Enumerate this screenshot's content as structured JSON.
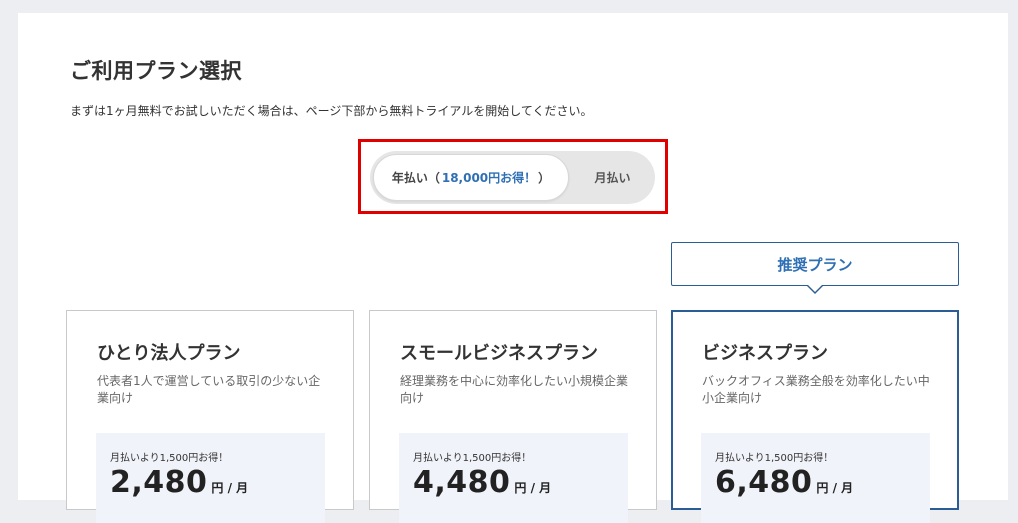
{
  "page": {
    "title": "ご利用プラン選択",
    "subtitle": "まずは1ヶ月無料でお試しいただく場合は、ページ下部から無料トライアルを開始してください。"
  },
  "billing_toggle": {
    "annual_label": "年払い（",
    "annual_discount": "18,000円お得！",
    "annual_close": "）",
    "monthly_label": "月払い",
    "selected": "annual"
  },
  "recommend_label": "推奨プラン",
  "plans": [
    {
      "name": "ひとり法人プラン",
      "description": "代表者1人で運営している取引の少ない企業向け",
      "price_note": "月払いより1,500円お得！",
      "price": "2,480",
      "unit": "円 / 月"
    },
    {
      "name": "スモールビジネスプラン",
      "description": "経理業務を中心に効率化したい小規模企業向け",
      "price_note": "月払いより1,500円お得！",
      "price": "4,480",
      "unit": "円 / 月"
    },
    {
      "name": "ビジネスプラン",
      "description": "バックオフィス業務全般を効率化したい中小企業向け",
      "price_note": "月払いより1,500円お得！",
      "price": "6,480",
      "unit": "円 / 月",
      "recommended": true
    }
  ],
  "colors": {
    "accent": "#2f6fb4",
    "featured_border": "#2a5d93",
    "highlight": "#e00000",
    "price_bg": "#f1f3fa"
  }
}
